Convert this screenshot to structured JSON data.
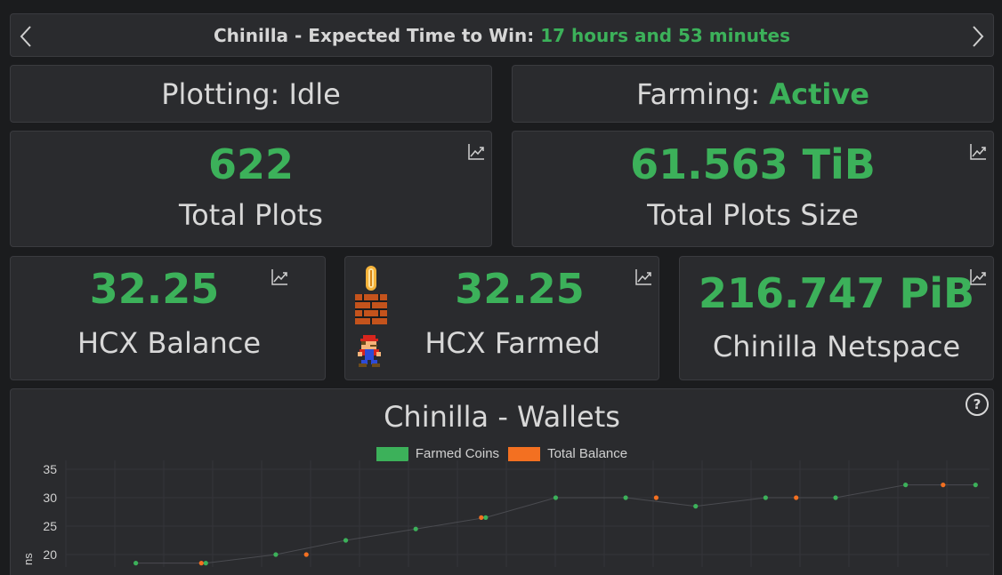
{
  "header": {
    "title_prefix": "Chinilla - Expected Time to Win: ",
    "title_value": "17 hours and 53 minutes"
  },
  "plotting": {
    "label": "Plotting: ",
    "value": "Idle"
  },
  "farming": {
    "label": "Farming: ",
    "value": "Active"
  },
  "total_plots": {
    "value": "622",
    "label": "Total Plots"
  },
  "total_plots_size": {
    "value": "61.563 TiB",
    "label": "Total Plots Size"
  },
  "hcx_balance": {
    "value": "32.25",
    "label": "HCX Balance"
  },
  "hcx_farmed": {
    "value": "32.25",
    "label": "HCX Farmed"
  },
  "netspace": {
    "value": "216.747 PiB",
    "label": "Chinilla Netspace"
  },
  "colors": {
    "green": "#3cb15a",
    "orange": "#f37021",
    "card": "#2a2b2e",
    "background": "#1b1c1e"
  },
  "wallets_chart": {
    "help_label": "?",
    "y_axis_label_fragment": "ns"
  },
  "chart_data": {
    "type": "scatter",
    "title": "Chinilla - Wallets",
    "ylabel": "",
    "xlabel": "",
    "ylim": [
      18,
      36
    ],
    "yticks": [
      "35",
      "30",
      "25",
      "20"
    ],
    "series": [
      {
        "name": "Farmed Coins",
        "color": "#3cb15a",
        "points": [
          [
            1,
            18.5
          ],
          [
            2,
            18.5
          ],
          [
            3,
            20
          ],
          [
            4,
            22.5
          ],
          [
            5,
            24.5
          ],
          [
            6,
            26.5
          ],
          [
            7,
            30
          ],
          [
            8,
            30
          ],
          [
            9,
            28.5
          ],
          [
            10,
            30
          ],
          [
            11,
            30
          ],
          [
            12,
            32.25
          ],
          [
            13,
            32.25
          ]
        ]
      },
      {
        "name": "Total Balance",
        "color": "#f37021",
        "points": [
          [
            2,
            18.5
          ],
          [
            3.5,
            20
          ],
          [
            6,
            26.5
          ],
          [
            8.5,
            30
          ],
          [
            10.5,
            30
          ],
          [
            12.6,
            32.25
          ]
        ]
      }
    ],
    "x_range": [
      0,
      13.2
    ]
  }
}
